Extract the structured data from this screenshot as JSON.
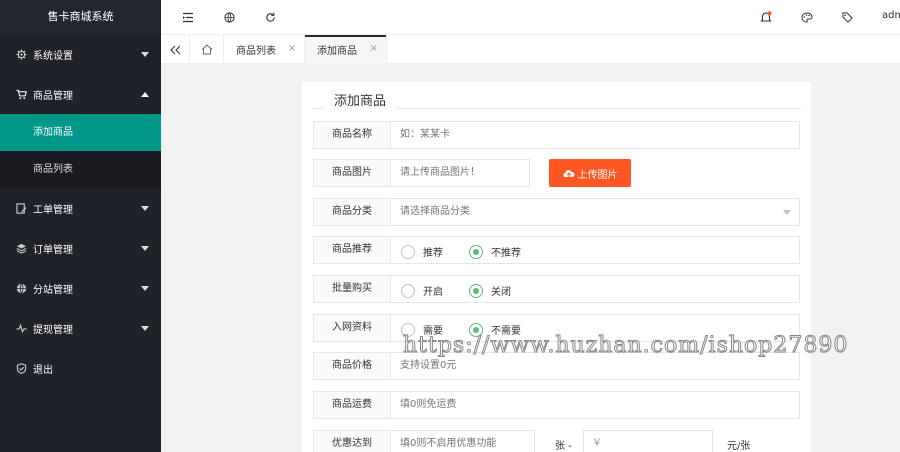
{
  "app": {
    "title": "售卡商城系统"
  },
  "sidebar": {
    "items": [
      {
        "label": "系统设置",
        "icon": "gear-icon"
      },
      {
        "label": "商品管理",
        "icon": "cart-icon"
      },
      {
        "label": "工单管理",
        "icon": "ticket-edit-icon"
      },
      {
        "label": "订单管理",
        "icon": "layers-icon"
      },
      {
        "label": "分站管理",
        "icon": "globe-icon"
      },
      {
        "label": "提现管理",
        "icon": "pulse-icon"
      },
      {
        "label": "退出",
        "icon": "shield-icon"
      }
    ],
    "sub_items": [
      {
        "label": "添加商品",
        "active": true
      },
      {
        "label": "商品列表",
        "active": false
      }
    ]
  },
  "header": {
    "user": "admin",
    "icons": [
      "menu-toggle-icon",
      "globe-icon",
      "refresh-icon",
      "bell-icon",
      "theme-icon",
      "tag-icon"
    ]
  },
  "tabs": [
    {
      "label": "商品列表",
      "active": false
    },
    {
      "label": "添加商品",
      "active": true
    }
  ],
  "form": {
    "title": "添加商品",
    "name": {
      "label": "商品名称",
      "placeholder": "如：某某卡"
    },
    "image": {
      "label": "商品图片",
      "placeholder": "请上传商品图片！",
      "button": "上传图片"
    },
    "category": {
      "label": "商品分类",
      "placeholder": "请选择商品分类"
    },
    "recommend": {
      "label": "商品推荐",
      "options": [
        "推荐",
        "不推荐"
      ],
      "selected": "不推荐"
    },
    "bulk": {
      "label": "批量购买",
      "options": [
        "开启",
        "关闭"
      ],
      "selected": "关闭"
    },
    "netinfo": {
      "label": "入网资料",
      "options": [
        "需要",
        "不需要"
      ],
      "selected": "不需要"
    },
    "price": {
      "label": "商品价格",
      "placeholder": "支持设置0元"
    },
    "shipping": {
      "label": "商品运费",
      "placeholder": "填0则免运费"
    },
    "discount": {
      "label": "优惠达到",
      "placeholder": "填0则不启用优惠功能",
      "unit1": "张 -",
      "price_placeholder": "￥",
      "unit2": "元/张"
    }
  },
  "watermark": "https://www.huzhan.com/ishop27890",
  "colors": {
    "sidebar_bg": "#20222a",
    "active": "#009688",
    "upload": "#ff5722",
    "radio_on": "#5fb878"
  }
}
